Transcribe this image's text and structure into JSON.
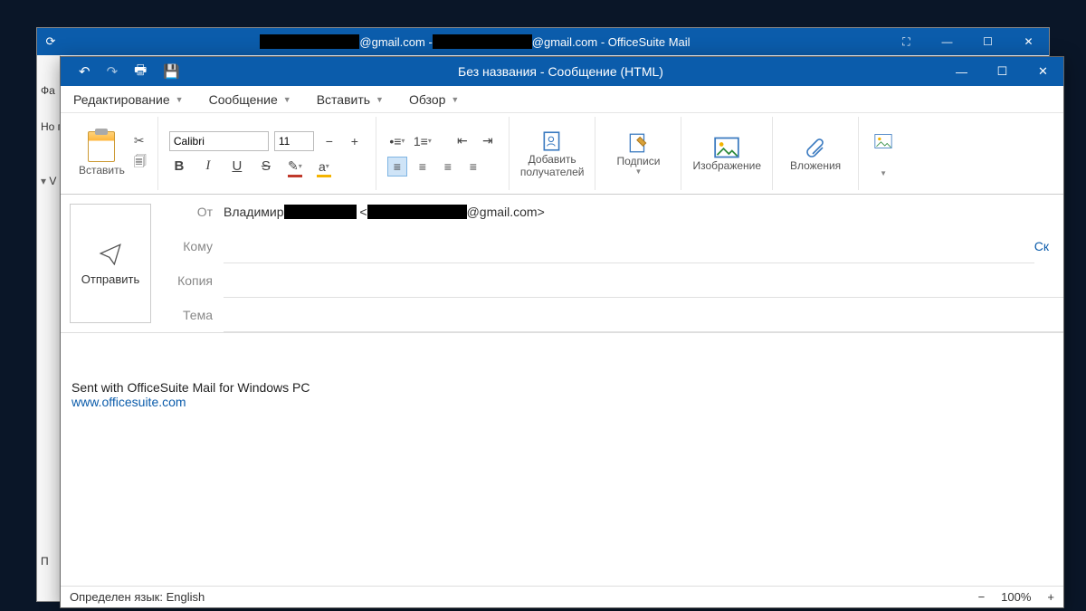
{
  "back_window": {
    "title_middle1": "@gmail.com - ",
    "title_middle2": "@gmail.com - OfficeSuite Mail",
    "left_items": [
      "Фа",
      "Но пи",
      "V",
      "П"
    ]
  },
  "compose_titlebar": {
    "title": "Без названия - Сообщение (HTML)"
  },
  "menus": {
    "edit": "Редактирование",
    "message": "Сообщение",
    "insert": "Вставить",
    "review": "Обзор"
  },
  "ribbon": {
    "paste": "Вставить",
    "font_name": "Calibri",
    "font_size": "11",
    "add_recipients_1": "Добавить",
    "add_recipients_2": "получателей",
    "signatures": "Подписи",
    "image": "Изображение",
    "attachments": "Вложения"
  },
  "fields": {
    "from_label": "От",
    "from_name": "Владимир ",
    "from_email_tail": "@gmail.com>",
    "to_label": "Кому",
    "cc_label": "Копия",
    "subject_label": "Тема",
    "cc_link": "Ск"
  },
  "body": {
    "signature": "Sent with OfficeSuite Mail for Windows PC",
    "link": "www.officesuite.com"
  },
  "status": {
    "lang_label": "Определен язык: English",
    "zoom": "100%"
  }
}
